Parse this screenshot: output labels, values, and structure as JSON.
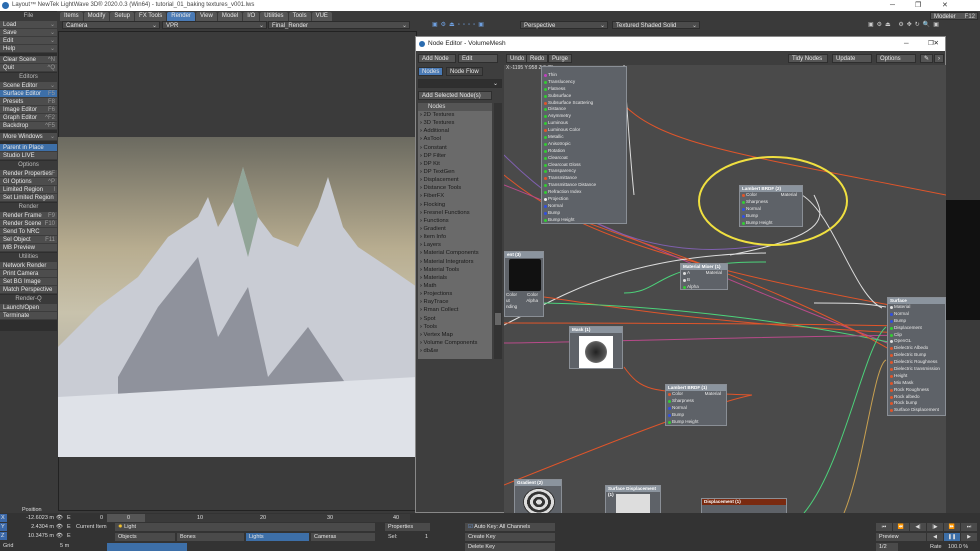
{
  "window": {
    "title": "Layout™ NewTek LightWave 3D® 2020.0.3 (Win64) - tutorial_01_baking textures_v001.lws",
    "minimize": "─",
    "maximize": "❐",
    "close": "✕"
  },
  "sidebar": {
    "sections": [
      {
        "header": "File",
        "items": [
          {
            "label": "Load",
            "key": "⌄"
          },
          {
            "label": "Save",
            "key": "⌄"
          },
          {
            "label": "Edit",
            "key": "⌄"
          },
          {
            "label": "Help",
            "key": "⌄"
          }
        ]
      },
      {
        "header": "",
        "items": [
          {
            "label": "Clear Scene",
            "key": "^N"
          },
          {
            "label": "Quit",
            "key": "^Q"
          }
        ]
      },
      {
        "header": "Editors",
        "items": [
          {
            "label": "Scene Editor",
            "key": "⌄"
          },
          {
            "label": "Surface Editor",
            "key": "F5",
            "selected": true
          },
          {
            "label": "Presets",
            "key": "F8"
          },
          {
            "label": "Image Editor",
            "key": "F6"
          },
          {
            "label": "Graph Editor",
            "key": "^F2"
          },
          {
            "label": "Backdrop",
            "key": "^F5"
          }
        ]
      },
      {
        "header": "",
        "items": [
          {
            "label": "More Windows",
            "key": "⌄"
          }
        ]
      },
      {
        "header": "",
        "items": [
          {
            "label": "Parent in Place",
            "key": "",
            "selected": true
          },
          {
            "label": "Studio LIVE",
            "key": ""
          }
        ]
      },
      {
        "header": "Options",
        "items": [
          {
            "label": "Render Properties",
            "key": "^F"
          },
          {
            "label": "GI Options",
            "key": "^P"
          },
          {
            "label": "Limited Region",
            "key": "l"
          },
          {
            "label": "Set Limited Region",
            "key": ""
          }
        ]
      },
      {
        "header": "Render",
        "items": [
          {
            "label": "Render Frame",
            "key": "F9"
          },
          {
            "label": "Render Scene",
            "key": "F10"
          },
          {
            "label": "Send To NRC",
            "key": ""
          },
          {
            "label": "Sel Object",
            "key": "F11"
          },
          {
            "label": "MB Preview",
            "key": ""
          }
        ]
      },
      {
        "header": "Utilities",
        "items": [
          {
            "label": "Network Render",
            "key": ""
          },
          {
            "label": "Print Camera",
            "key": ""
          },
          {
            "label": "Set BG Image",
            "key": ""
          },
          {
            "label": "Match Perspective",
            "key": ""
          }
        ]
      },
      {
        "header": "Render-Q",
        "items": [
          {
            "label": "Launch/Open",
            "key": ""
          },
          {
            "label": "Terminate",
            "key": ""
          }
        ]
      }
    ]
  },
  "tabs": [
    {
      "label": "Items"
    },
    {
      "label": "Modify"
    },
    {
      "label": "Setup"
    },
    {
      "label": "FX Tools"
    },
    {
      "label": "Render",
      "active": true
    },
    {
      "label": "View"
    },
    {
      "label": "Model"
    },
    {
      "label": "I/O"
    },
    {
      "label": "Utilities"
    },
    {
      "label": "Tools"
    },
    {
      "label": "VUE"
    }
  ],
  "modeler": {
    "label": "Modeler",
    "key": "F12"
  },
  "viewport_left": {
    "camera": "Camera",
    "mode": "VPR",
    "preset": "Final_Render"
  },
  "viewport_right": {
    "view": "Perspective",
    "shading": "Textured Shaded Solid"
  },
  "node_editor": {
    "title": "Node Editor - VolumeMesh",
    "toolbar": {
      "add_node": "Add Node",
      "edit": "Edit",
      "undo": "Undo",
      "redo": "Redo",
      "purge": "Purge",
      "tidy": "Tidy Nodes",
      "update": "Update",
      "options": "Options"
    },
    "tabs": {
      "nodes": "Nodes",
      "node_flow": "Node Flow"
    },
    "add_selected": "Add Selected Node(s)",
    "list_header": "Nodes",
    "categories": [
      "2D Textures",
      "3D Textures",
      "Additional",
      "AsTool",
      "Constant",
      "DP Filter",
      "DP Kit",
      "DP TextGen",
      "Displacement",
      "Distance Tools",
      "FiberFX",
      "Flocking",
      "Fresnel Functions",
      "Functions",
      "Gradient",
      "Item Info",
      "Layers",
      "Material Components",
      "Material Integrators",
      "Material Tools",
      "Materials",
      "Math",
      "Projections",
      "RayTrace",
      "Rman Collect",
      "Spot",
      "Tools",
      "Vertex Map",
      "Volume Components",
      "db&w"
    ],
    "coords": "X:-1195 Y:958 Z:0 (?)",
    "big_node_inputs": [
      "Thin",
      "Translucency",
      "Flatness",
      "Subsurface",
      "Subsurface Scattering",
      "Distance",
      "Asymmetry",
      "Luminous",
      "Luminous Color",
      "Metallic",
      "Anisotropic",
      "Rotation",
      "Clearcoat",
      "Clearcoat Gloss",
      "Transparency",
      "Transmittance",
      "Transmittance Distance",
      "Refraction Index",
      "Projection",
      "Normal",
      "Bump",
      "Bump Height"
    ],
    "gradient_node": {
      "title": "ent (3)",
      "left": [
        "Color",
        "ut",
        "nding"
      ],
      "out_color": "Color",
      "out_alpha": "Alpha"
    },
    "mixer": {
      "title": "Material Mixer (1)",
      "inputs": [
        "A",
        "B",
        "Alpha"
      ],
      "output": "Material"
    },
    "mask": {
      "title": "Mask (1)"
    },
    "lambert1": {
      "title": "Lambert BRDF (1)",
      "inputs": [
        "Color",
        "Sharpness",
        "Normal",
        "Bump",
        "Bump Height"
      ],
      "output": "Material"
    },
    "lambert2": {
      "title": "Lambert BRDF (2)",
      "inputs": [
        "Color",
        "Sharpness",
        "Normal",
        "Bump",
        "Bump Height"
      ],
      "output": "Material"
    },
    "surface": {
      "title": "Surface",
      "inputs": [
        "Material",
        "Normal",
        "Bump",
        "Displacement",
        "Clip",
        "OpenGL",
        "Dielectric Albedo",
        "Dielectric Bump",
        "Dielectric Roughness",
        "Dielectric transmission",
        "Height",
        "Mix Mask",
        "Rock Roughness",
        "Rock albedo",
        "Rock bump",
        "Surface Displacement"
      ]
    },
    "gradient2": {
      "title": "Gradient (2)"
    },
    "surfdisp": {
      "title": "Surface Displacement (1)"
    },
    "displacement": {
      "title": "Displacement (1)"
    },
    "highlight_color": "#f0e040"
  },
  "bottom": {
    "position_label": "Position",
    "x": "-12.6023 m",
    "y": "2.4304 m",
    "z": "10.3475 m",
    "grid_label": "Grid",
    "grid": "5 m",
    "frame": "0",
    "ticks": [
      "0",
      "10",
      "20",
      "30",
      "40"
    ],
    "current_item_label": "Current Item",
    "current_item": "Light",
    "objects": "Objects",
    "bones": "Bones",
    "lights": "Lights",
    "cameras": "Cameras",
    "properties": "Properties",
    "sel_label": "Sel:",
    "sel": "1",
    "autokey": "Auto Key: All Channels",
    "create_key": "Create Key",
    "delete_key": "Delete Key",
    "preview": "Preview",
    "rate_label": "Rate",
    "rate": "100.0 %",
    "step": "1/2"
  }
}
